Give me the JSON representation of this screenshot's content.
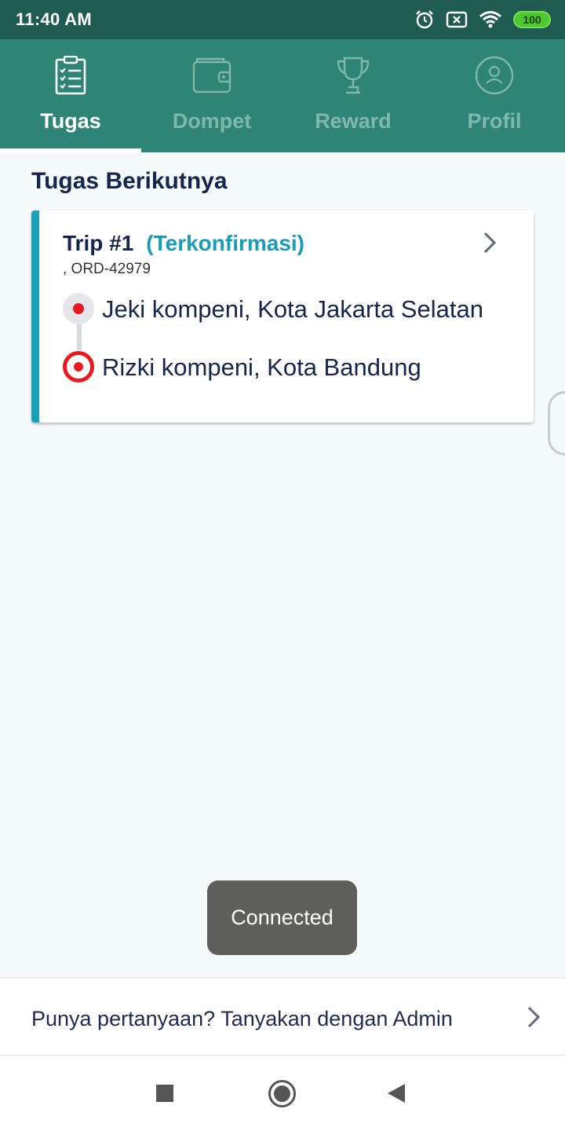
{
  "status_bar": {
    "time": "11:40 AM",
    "battery": "100",
    "icons": [
      "alarm-icon",
      "sim-off-icon",
      "wifi-icon",
      "battery-icon"
    ]
  },
  "tabs": [
    {
      "label": "Tugas",
      "icon": "clipboard-checklist-icon",
      "active": true
    },
    {
      "label": "Dompet",
      "icon": "wallet-icon",
      "active": false
    },
    {
      "label": "Reward",
      "icon": "trophy-icon",
      "active": false
    },
    {
      "label": "Profil",
      "icon": "profile-icon",
      "active": false
    }
  ],
  "section_title": "Tugas Berikutnya",
  "trip": {
    "title": "Trip #1",
    "status": "(Terkonfirmasi)",
    "order": ", ORD-42979",
    "origin": "Jeki kompeni, Kota Jakarta Selatan",
    "destination": "Rizki kompeni, Kota Bandung"
  },
  "toast": "Connected",
  "help": {
    "text": "Punya pertanyaan? Tanyakan dengan Admin"
  },
  "colors": {
    "status_bar": "#1f5b50",
    "tab_bar": "#2e8575",
    "accent": "#1a9cb8",
    "pin_red": "#e8191f",
    "text_dark": "#15254d"
  }
}
